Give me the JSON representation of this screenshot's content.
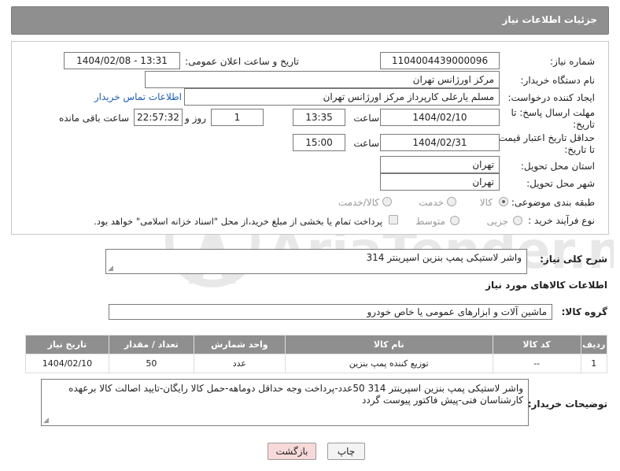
{
  "header": {
    "title": "جزئیات اطلاعات نیاز"
  },
  "form": {
    "need_number_label": "شماره نیاز:",
    "need_number": "1104004439000096",
    "announce_label": "تاریخ و ساعت اعلان عمومی:",
    "announce_value": "1404/02/08 - 13:31",
    "buyer_org_label": "نام دستگاه خریدار:",
    "buyer_org": "مرکز اورژانس تهران",
    "requester_label": "ایجاد کننده درخواست:",
    "requester": "مسلم یارعلی کارپرداز مرکز اورژانس تهران",
    "contact_link": "اطلاعات تماس خریدار",
    "reply_deadline_label_1": "مهلت ارسال پاسخ: تا",
    "reply_deadline_label_2": "تاریخ:",
    "reply_date": "1404/02/10",
    "hour_label": "ساعت",
    "reply_time": "13:35",
    "days_value": "1",
    "days_label": "روز و",
    "remaining_time": "22:57:32",
    "remaining_label": "ساعت باقی مانده",
    "validity_label_1": "حداقل تاریخ اعتبار قیمت:",
    "validity_label_2": "تا تاریخ:",
    "validity_date": "1404/02/31",
    "validity_hour_label": "ساعت",
    "validity_time": "15:00",
    "province_label": "استان محل تحویل:",
    "province": "تهران",
    "city_label": "شهر محل تحویل:",
    "city": "تهران",
    "category_label": "طبقه بندی موضوعی:",
    "category_options": [
      "کالا",
      "خدمت",
      "کالا/خدمت"
    ],
    "category_selected": "کالا",
    "process_label": "نوع فرآیند خرید :",
    "process_options": [
      "جزیی",
      "متوسط"
    ],
    "payment_note": "پرداخت تمام یا بخشی از مبلغ خرید،از محل \"اسناد خزانه اسلامی\" خواهد بود."
  },
  "summary": {
    "label": "شرح کلی نیاز:",
    "value": "واشر لاستیکی پمپ بنزین اسپرینتر 314"
  },
  "goods_section": {
    "title": "اطلاعات کالاهای مورد نیاز",
    "group_label": "گروه کالا:",
    "group_value": "ماشین آلات و ابزارهای عمومی یا خاص خودرو"
  },
  "table": {
    "headers": [
      "ردیف",
      "کد کالا",
      "نام کالا",
      "واحد شمارش",
      "تعداد / مقدار",
      "تاریخ نیاز"
    ],
    "rows": [
      [
        "1",
        "--",
        "توزیع کننده پمپ بنزین",
        "عدد",
        "50",
        "1404/02/10"
      ]
    ]
  },
  "notes": {
    "label": "توضیحات خریدار:",
    "line1": "واشر لاستیکی پمپ بنزین اسپرینتر 314   50عدد-پرداخت وجه حداقل دوماهه-حمل کالا رایگان-تایید اصالت کالا برعهده",
    "line2": "کارشناسان فنی-پیش فاکتور پیوست گردد"
  },
  "buttons": {
    "print": "چاپ",
    "back": "بازگشت"
  },
  "watermark": {
    "text": "AriaTender.net"
  },
  "colors": {
    "header_bg": "#8f8f8f",
    "link": "#1a5fb4",
    "back_button_bg": "#f7d9da"
  }
}
